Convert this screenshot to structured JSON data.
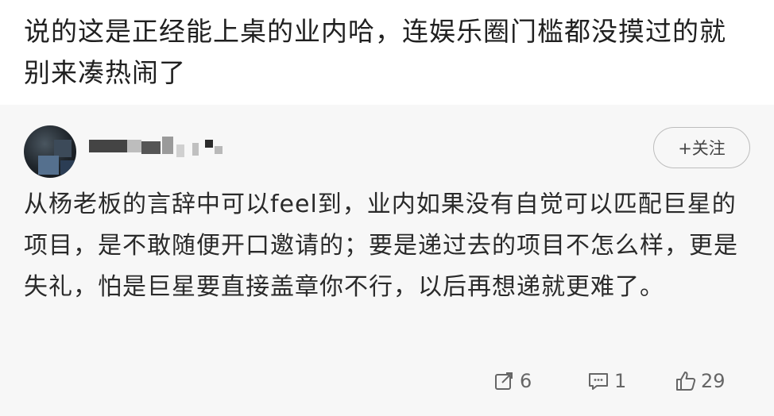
{
  "post": {
    "text": "说的这是正经能上桌的业内哈，连娱乐圈门槛都没摸过的就别来凑热闹了"
  },
  "reply": {
    "follow_label": "+关注",
    "comment_text": "从杨老板的言辞中可以feel到，业内如果没有自觉可以匹配巨星的项目，是不敢随便开口邀请的；要是递过去的项目不怎么样，更是失礼，怕是巨星要直接盖章你不行，以后再想递就更难了。",
    "repost_count": "6",
    "comment_count": "1",
    "like_count": "29",
    "icons": {
      "repost": "repost-icon",
      "comment": "comment-icon",
      "like": "like-icon"
    }
  }
}
